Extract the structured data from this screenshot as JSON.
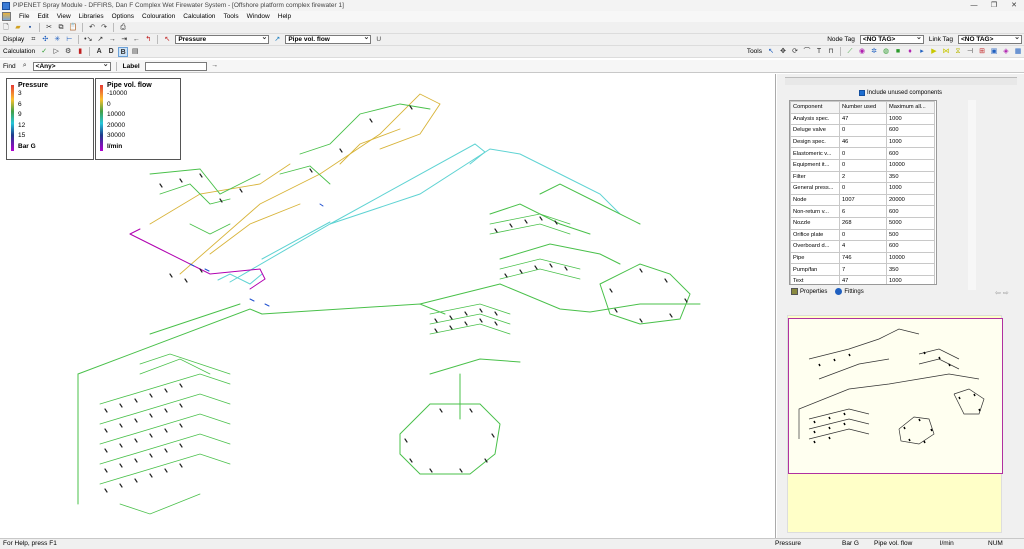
{
  "window": {
    "title": "PIPENET Spray Module - DFFIRS, Dan F Complex Wet Firewater System - [Offshore platform complex firewater 1]"
  },
  "menu": [
    "File",
    "Edit",
    "View",
    "Libraries",
    "Options",
    "Colouration",
    "Calculation",
    "Tools",
    "Window",
    "Help"
  ],
  "toolbar": {
    "display_label": "Display",
    "pressure_combo": "Pressure",
    "flow_combo": "Pipe vol. flow",
    "u_label": "U",
    "node_tag_label": "Node Tag",
    "node_tag_value": "<NO TAG>",
    "link_tag_label": "Link Tag",
    "link_tag_value": "<NO TAG>",
    "calculation_label": "Calculation",
    "a_label": "A",
    "d_label": "D",
    "b_label": "B",
    "tools_label": "Tools",
    "find_label": "Find",
    "find_value": "<Any>",
    "label_label": "Label"
  },
  "legends": {
    "pressure": {
      "title": "Pressure",
      "values": [
        "3",
        "6",
        "9",
        "12",
        "15"
      ],
      "unit": "Bar G"
    },
    "flow": {
      "title": "Pipe vol. flow",
      "values": [
        "-10000",
        "0",
        "10000",
        "20000",
        "30000"
      ],
      "unit": "l/min"
    }
  },
  "panel": {
    "include_unused": "Include unused components",
    "columns": [
      "Component",
      "Number used",
      "Maximum all..."
    ],
    "rows": [
      [
        "Analysis spec.",
        "47",
        "1000"
      ],
      [
        "Deluge valve",
        "0",
        "600"
      ],
      [
        "Design spec.",
        "46",
        "1000"
      ],
      [
        "Elastomeric v...",
        "0",
        "600"
      ],
      [
        "Equipment it...",
        "0",
        "10000"
      ],
      [
        "Filter",
        "2",
        "350"
      ],
      [
        "General press...",
        "0",
        "1000"
      ],
      [
        "Node",
        "1007",
        "20000"
      ],
      [
        "Non-return v...",
        "6",
        "600"
      ],
      [
        "Nozzle",
        "268",
        "5000"
      ],
      [
        "Orifice plate",
        "0",
        "500"
      ],
      [
        "Overboard d...",
        "4",
        "600"
      ],
      [
        "Pipe",
        "746",
        "10000"
      ],
      [
        "Pump/fan",
        "7",
        "350"
      ],
      [
        "Text",
        "47",
        "1000"
      ]
    ],
    "tab_properties": "Properties",
    "tab_fittings": "Fittings"
  },
  "status": {
    "help": "For Help, press F1",
    "pressure": "Pressure",
    "pressure_unit": "Bar G",
    "flow": "Pipe vol. flow",
    "flow_unit": "l/min",
    "num": "NUM"
  },
  "colors": {
    "pipe_green": "#3fbf3f",
    "pipe_cyan": "#4fd0d0",
    "pipe_yellow": "#d8b23a",
    "pipe_magenta": "#b000b0",
    "overview_bg": "#ffffc8"
  }
}
